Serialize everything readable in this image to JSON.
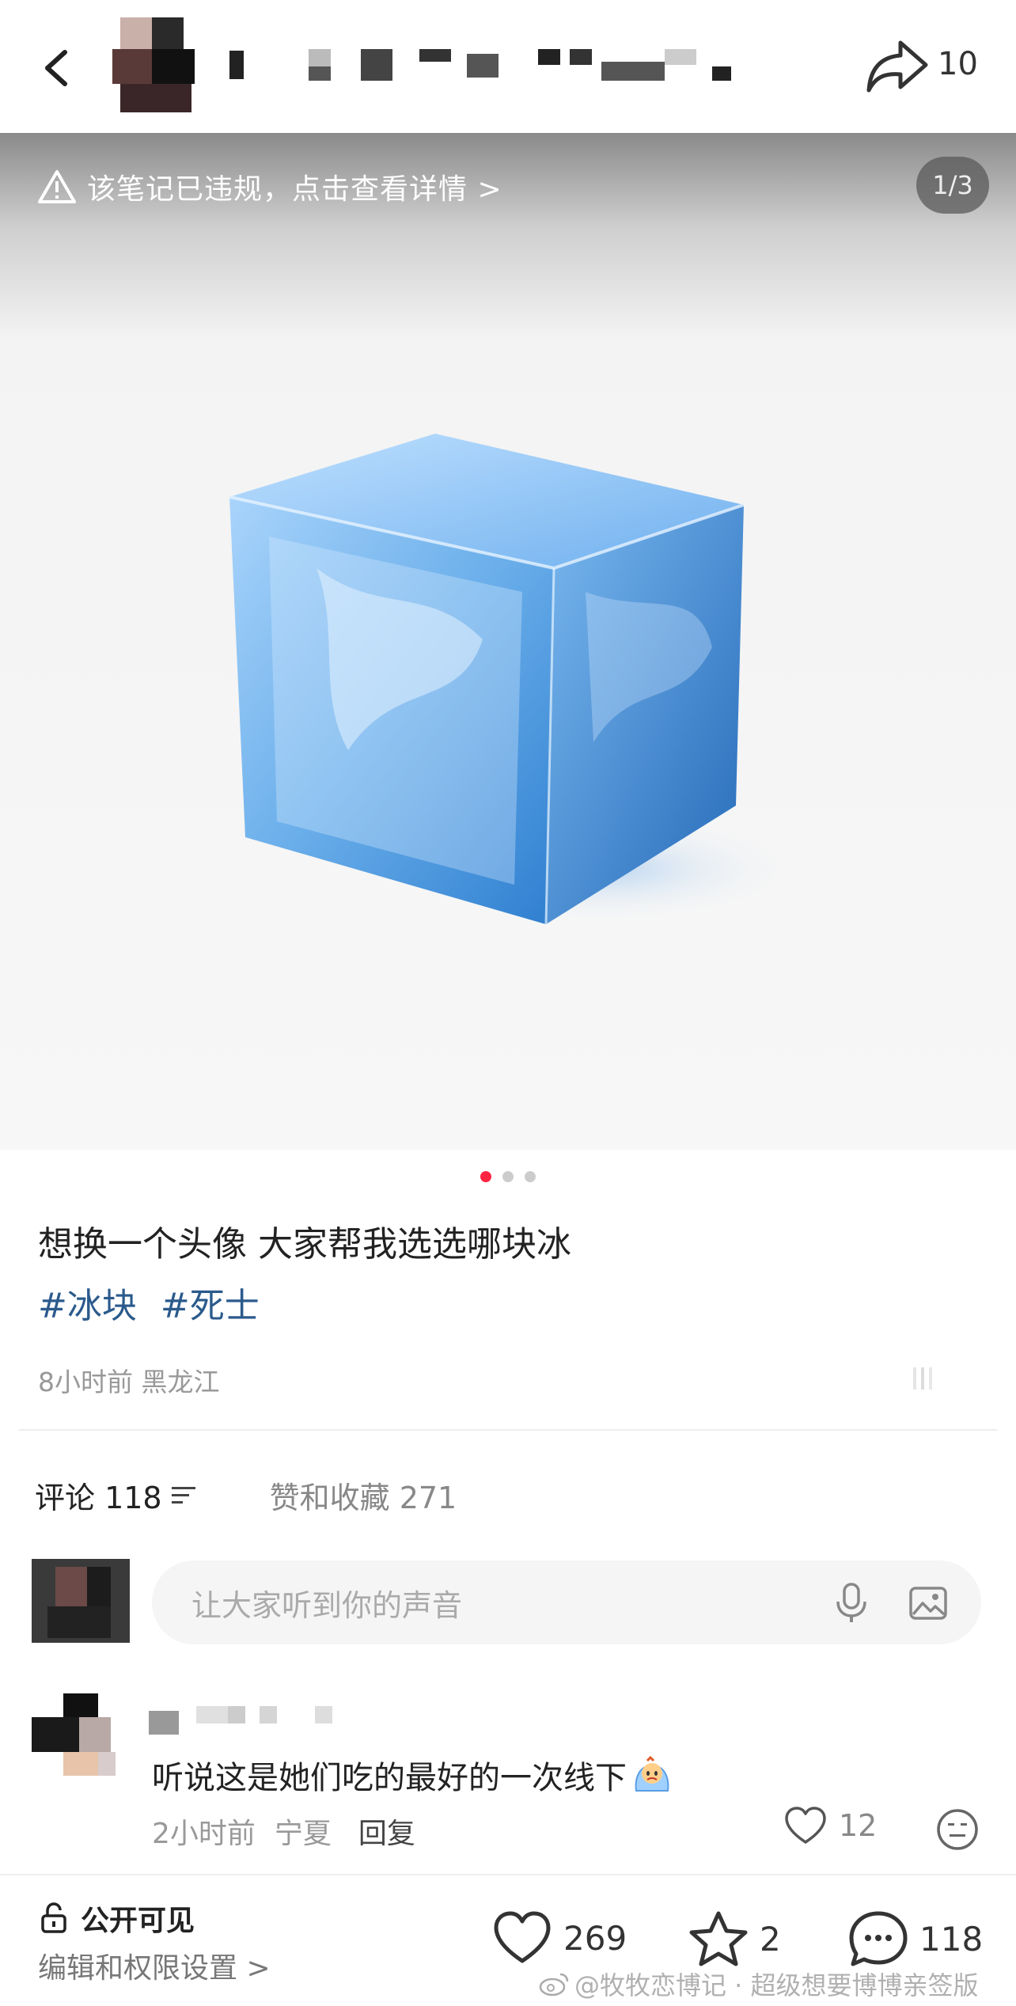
{
  "header": {
    "share_count": "10",
    "icons": [
      "back-icon",
      "share-icon"
    ]
  },
  "image": {
    "violation_notice": "该笔记已违规，点击查看详情 >",
    "page_counter": "1/3",
    "icons": [
      "warning-icon"
    ]
  },
  "post": {
    "title": "想换一个头像  大家帮我选选哪块冰",
    "tags": [
      "#冰块",
      "#死士"
    ],
    "meta": "8小时前 黑龙江"
  },
  "tabs": {
    "comments_label": "评论 118",
    "likes_label": "赞和收藏 271"
  },
  "comment_input": {
    "placeholder": "让大家听到你的声音"
  },
  "comments": [
    {
      "text": "听说这是她们吃的最好的一次线下",
      "time": "2小时前",
      "location": "宁夏",
      "reply_label": "回复",
      "likes": "12"
    }
  ],
  "bottom_bar": {
    "visibility": "公开可见",
    "permissions": "编辑和权限设置 >",
    "likes": "269",
    "stars": "2",
    "comments": "118"
  },
  "watermark": "@牧牧恋博记 · 超级想要博博亲签版",
  "colors": {
    "accent": "#ff2442",
    "tag": "#2b5a8c",
    "ice": "#4a90d9"
  }
}
